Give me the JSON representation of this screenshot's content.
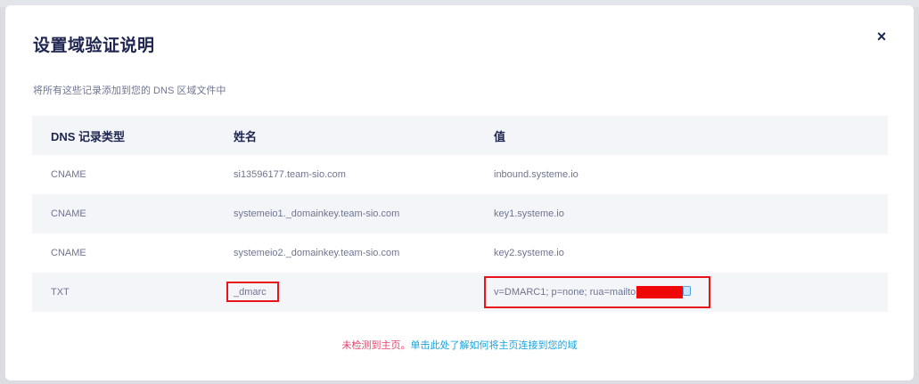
{
  "dialog": {
    "title": "设置域验证说明",
    "close_symbol": "×",
    "subtitle": "将所有这些记录添加到您的 DNS 区域文件中"
  },
  "table": {
    "headers": [
      "DNS 记录类型",
      "姓名",
      "值"
    ],
    "rows": [
      [
        "CNAME",
        "si13596177.team-sio.com",
        "inbound.systeme.io"
      ],
      [
        "CNAME",
        "systemeio1._domainkey.team-sio.com",
        "key1.systeme.io"
      ],
      [
        "CNAME",
        "systemeio2._domainkey.team-sio.com",
        "key2.systeme.io"
      ],
      [
        "TXT",
        "_dmarc",
        "v=DMARC1; p=none; rua=mailto"
      ]
    ]
  },
  "footer": {
    "warning": "未检测到主页。",
    "link": "单击此处了解如何将主页连接到您的域"
  },
  "colors": {
    "title": "#1d2550",
    "muted_text": "#6f7592",
    "row_stripe": "#f4f5f8",
    "highlight_box": "#e8131b",
    "warning": "#e8436b",
    "link": "#1aa3dc"
  }
}
